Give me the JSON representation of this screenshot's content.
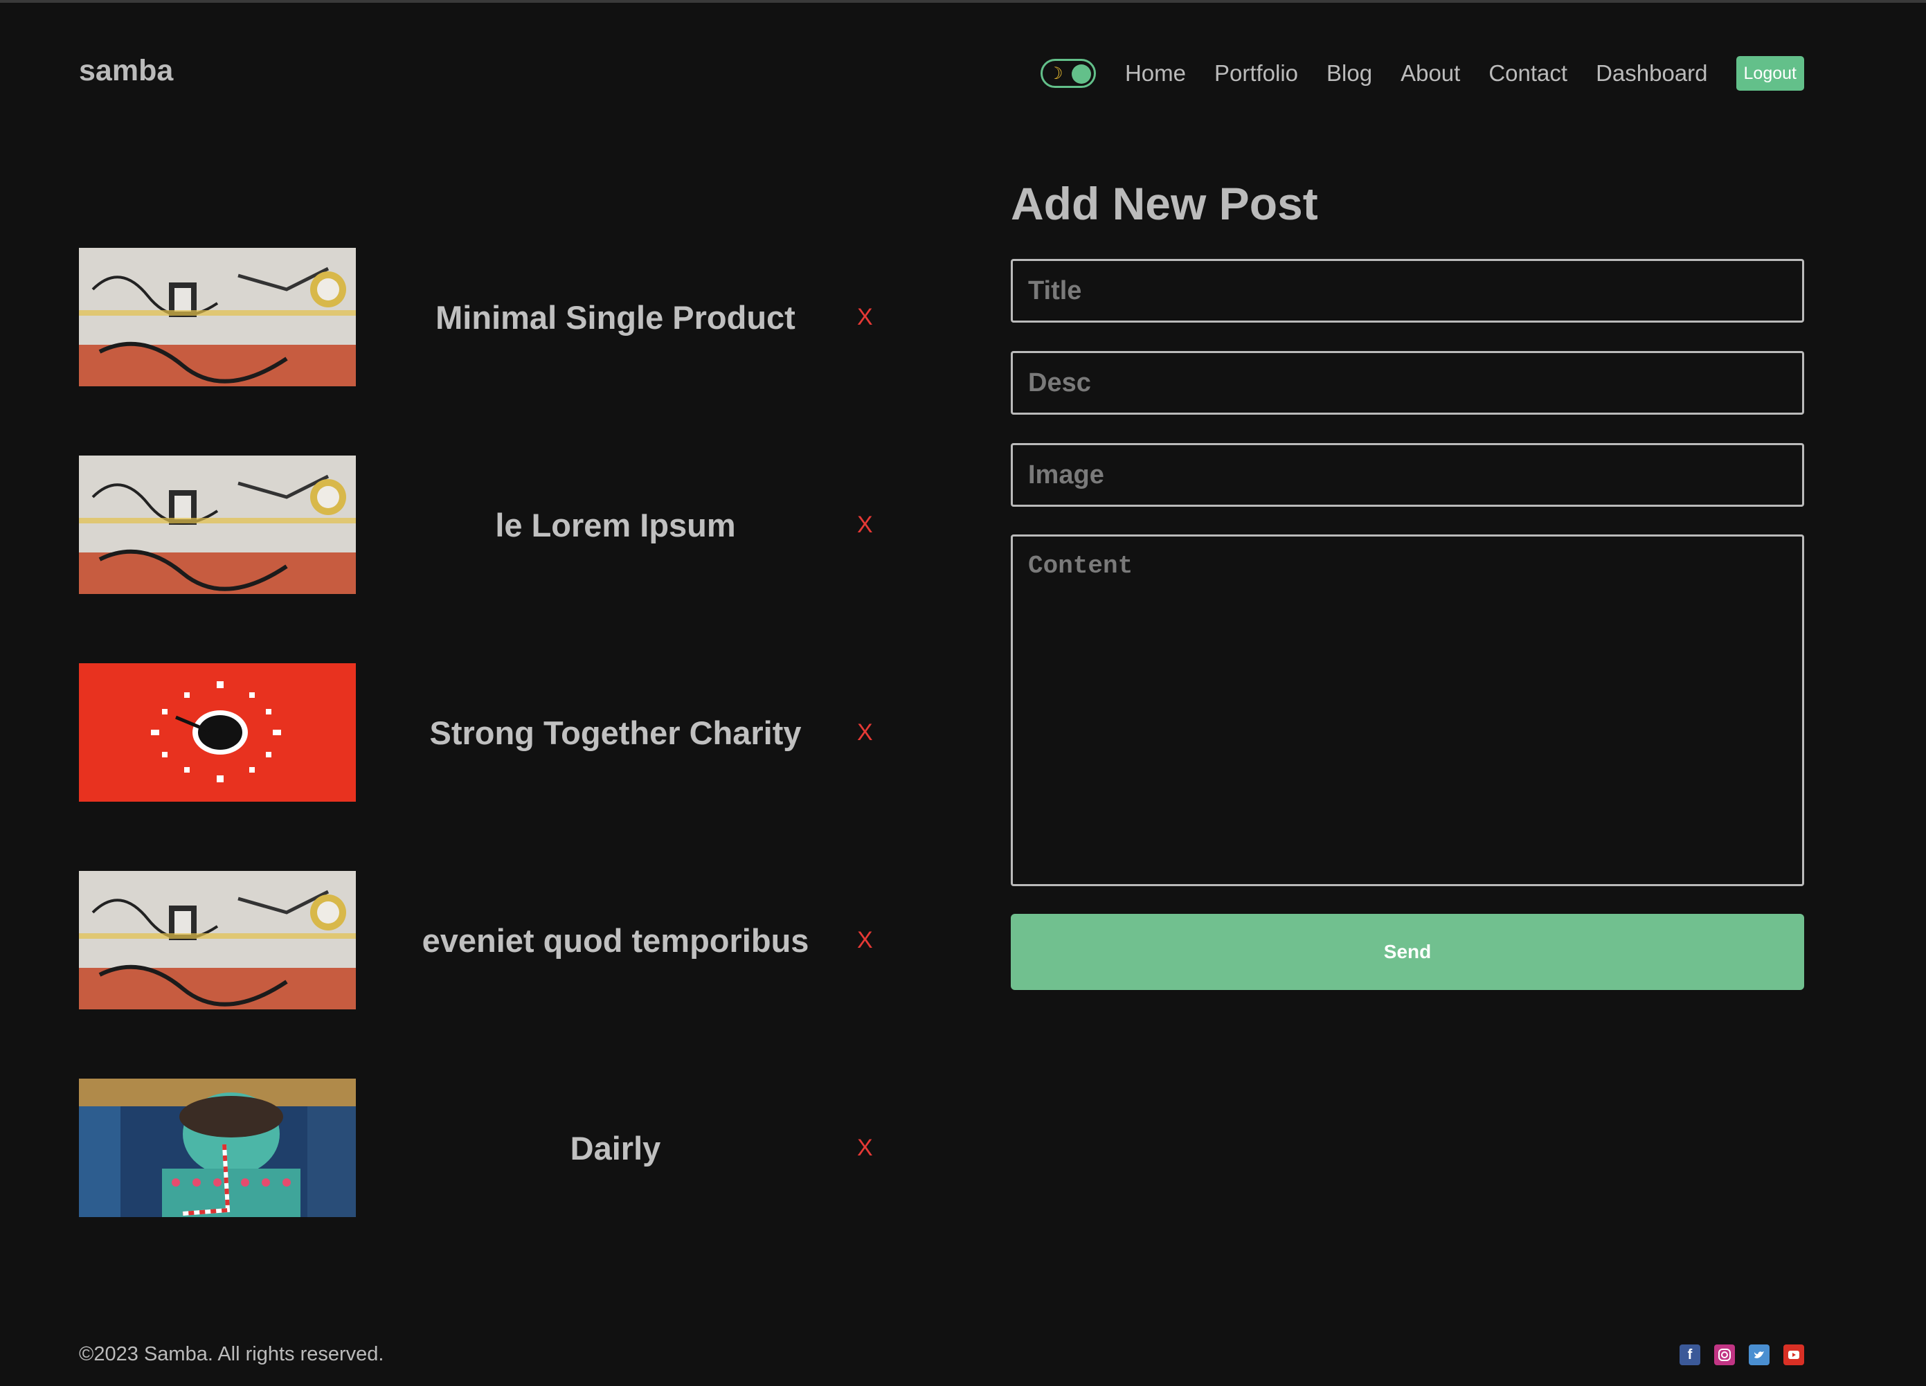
{
  "header": {
    "logo": "samba",
    "nav": [
      "Home",
      "Portfolio",
      "Blog",
      "About",
      "Contact",
      "Dashboard"
    ],
    "logout_label": "Logout",
    "theme_toggle_icon": "moon-icon"
  },
  "posts": [
    {
      "title": "Minimal Single Product",
      "delete_label": "X",
      "image": "street-mural"
    },
    {
      "title": "le Lorem Ipsum",
      "delete_label": "X",
      "image": "street-mural"
    },
    {
      "title": "Strong Together Charity",
      "delete_label": "X",
      "image": "red-coffee-clock"
    },
    {
      "title": "eveniet quod temporibus",
      "delete_label": "X",
      "image": "street-mural"
    },
    {
      "title": "Dairly",
      "delete_label": "X",
      "image": "teal-girl-mural"
    }
  ],
  "form": {
    "heading": "Add New Post",
    "title_placeholder": "Title",
    "desc_placeholder": "Desc",
    "image_placeholder": "Image",
    "content_placeholder": "Content",
    "send_label": "Send"
  },
  "footer": {
    "copyright": "©2023 Samba. All rights reserved.",
    "socials": [
      "facebook-icon",
      "instagram-icon",
      "twitter-icon",
      "youtube-icon"
    ]
  },
  "colors": {
    "background": "#111111",
    "accent": "#71c08f",
    "danger": "#e53935",
    "text": "#bbbbbb"
  }
}
